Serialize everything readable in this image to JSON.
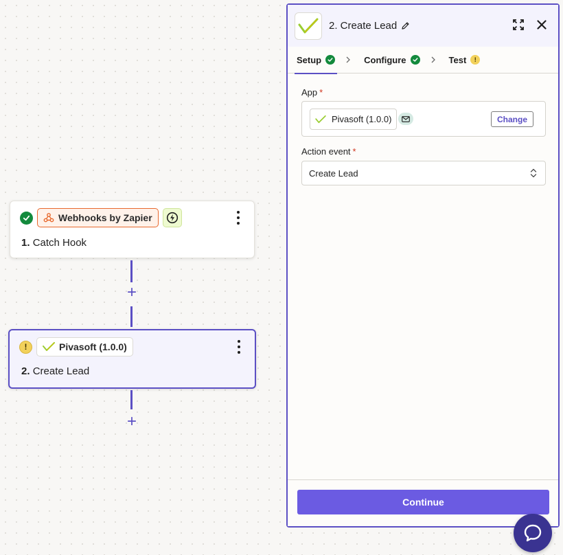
{
  "canvas": {
    "trigger_step": {
      "app_name": "Webhooks by Zapier",
      "step_number": "1.",
      "step_name": "Catch Hook",
      "status": "complete"
    },
    "action_step": {
      "app_name": "Pivasoft (1.0.0)",
      "step_number": "2.",
      "step_name": "Create Lead",
      "status": "warning"
    },
    "plus_symbol": "+"
  },
  "panel": {
    "title": "2. Create Lead",
    "tabs": [
      {
        "label": "Setup",
        "status": "ok",
        "active": true
      },
      {
        "label": "Configure",
        "status": "ok",
        "active": false
      },
      {
        "label": "Test",
        "status": "warn",
        "active": false
      }
    ],
    "app_field": {
      "label": "App",
      "required_mark": "*",
      "selected_app": "Pivasoft (1.0.0)",
      "change_label": "Change"
    },
    "action_event_field": {
      "label": "Action event",
      "required_mark": "*",
      "value": "Create Lead"
    },
    "continue_label": "Continue"
  },
  "icons": {
    "ok": "check-circle-icon",
    "warn": "exclamation-circle-icon",
    "webhook": "webhook-icon",
    "bolt": "lightning-bolt-icon",
    "pivasoft": "pivasoft-check-logo",
    "edit": "pencil-icon",
    "expand": "expand-icon",
    "close": "close-icon",
    "chevron": "chevron-right-icon",
    "mail": "mail-icon",
    "select": "up-down-chevron-icon",
    "chat": "chat-bubble-icon"
  },
  "colors": {
    "accent": "#5b4fc4",
    "button": "#6b5be2",
    "success": "#138a3d",
    "warning": "#f2d15b",
    "webhooks_brand": "#e8682c",
    "required": "#d0361f"
  }
}
